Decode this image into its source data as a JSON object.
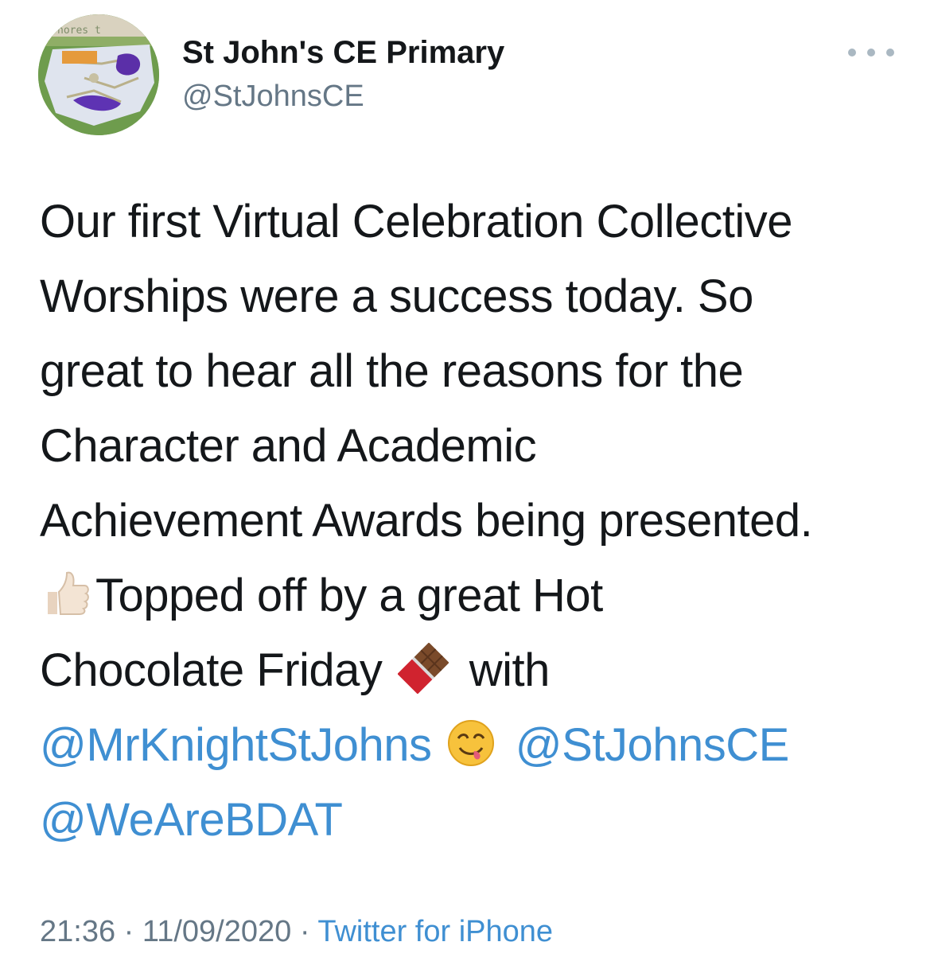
{
  "author": {
    "name": "St John's CE Primary",
    "handle": "@StJohnsCE",
    "avatar_lettering": "nores t"
  },
  "more_icon": "more-dots-icon",
  "tweet": {
    "line1": "Our first Virtual Celebration Collective",
    "line2": "Worships were a success today. So",
    "line3": "great to hear all the reasons for the",
    "line4": "Character and Academic",
    "line5": "Achievement Awards being presented.",
    "line6_text": "Topped off by a great Hot",
    "line7_text_a": "Chocolate Friday",
    "line7_text_b": "with",
    "mention1": "@MrKnightStJohns",
    "mention2": "@StJohnsCE",
    "mention3": "@WeAreBDAT",
    "emojis": {
      "thumbs": "thumbs-up-emoji",
      "chocolate": "chocolate-bar-emoji",
      "yum": "savoring-face-emoji"
    }
  },
  "footer": {
    "time": "21:36",
    "separator1": "·",
    "date": "11/09/2020",
    "separator2": "·",
    "source": "Twitter for iPhone"
  },
  "colors": {
    "text": "#14171a",
    "secondary": "#657786",
    "link": "#3f8fd2"
  }
}
